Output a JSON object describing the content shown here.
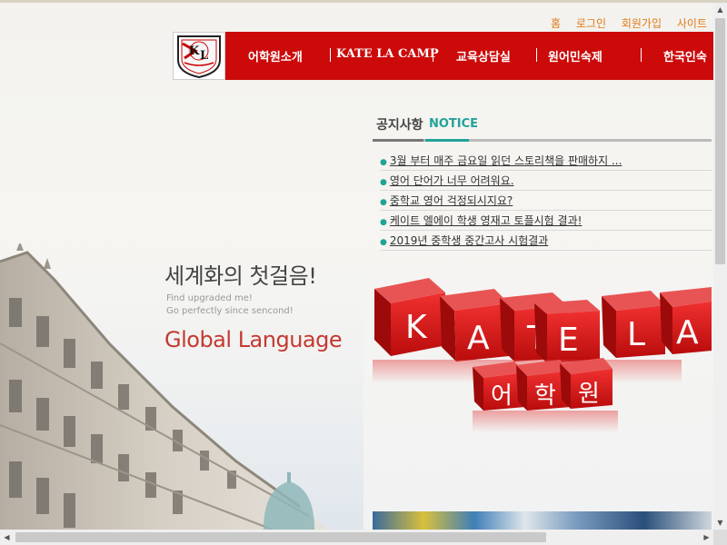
{
  "top_links": [
    "홈",
    "로그인",
    "회원가입",
    "사이트"
  ],
  "nav": [
    "어학원소개",
    "KATE LA CAMP",
    "교육상담실",
    "원어민숙제",
    "한국인숙"
  ],
  "hero": {
    "title": "세계화의 첫걸음!",
    "sub1": "Find upgraded me!",
    "sub2": "Go perfectly since sencond!",
    "gl": "Global Language"
  },
  "notice": {
    "title_ko": "공지사항",
    "title_en": "NOTICE",
    "items": [
      "3월 부터 매주 금요일 읽던 스토리책을 판매하지 ...",
      "영어 단어가 너무 어려워요.",
      "중학교 영어 걱정되시지요?",
      "케이트 엘에이 학생 영재고 토플시험 결과!",
      "2019년 중학생 중간고사 시험결과"
    ]
  },
  "banner": {
    "letters": [
      "K",
      "A",
      "T",
      "E",
      "L",
      "A"
    ],
    "sub_letters": [
      "어",
      "학",
      "원"
    ]
  },
  "colors": {
    "nav_red": "#cc0a0a",
    "teal": "#21a39a",
    "orange": "#e07b1a"
  }
}
